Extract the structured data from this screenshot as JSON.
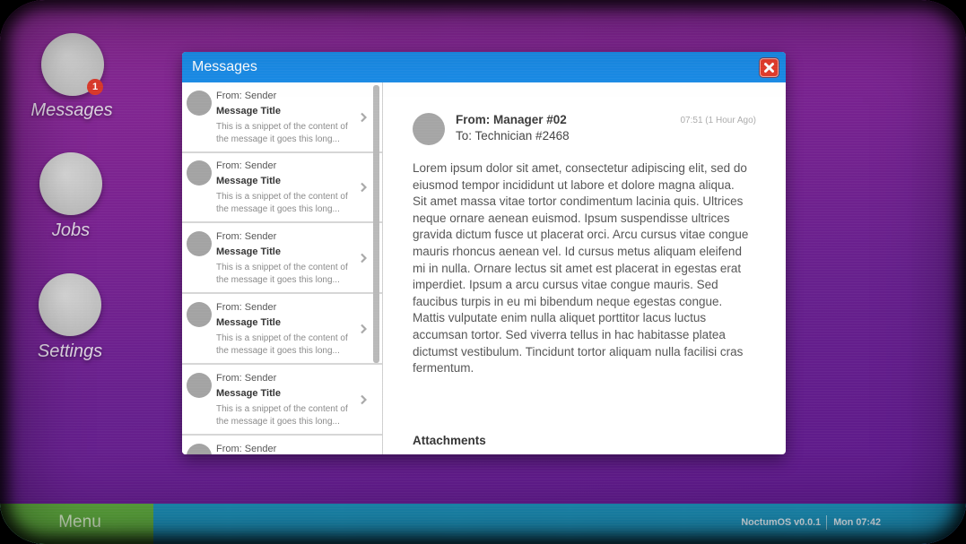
{
  "desktop": {
    "icons": [
      {
        "label": "Messages",
        "badge": "1"
      },
      {
        "label": "Jobs"
      },
      {
        "label": "Settings"
      }
    ]
  },
  "window": {
    "title": "Messages",
    "close_icon": "close-icon"
  },
  "message_list": {
    "item_icon": "chevron-right-icon",
    "items": [
      {
        "from": "From: Sender",
        "title": "Message Title",
        "snippet": "This is a snippet of the content of the message it goes this long..."
      },
      {
        "from": "From: Sender",
        "title": "Message Title",
        "snippet": "This is a snippet of the content of the message it goes this long..."
      },
      {
        "from": "From: Sender",
        "title": "Message Title",
        "snippet": "This is a snippet of the content of the message it goes this long..."
      },
      {
        "from": "From: Sender",
        "title": "Message Title",
        "snippet": "This is a snippet of the content of the message it goes this long..."
      },
      {
        "from": "From: Sender",
        "title": "Message Title",
        "snippet": "This is a snippet of the content of the message it goes this long..."
      },
      {
        "from": "From: Sender"
      }
    ]
  },
  "message": {
    "from": "From: Manager #02",
    "to": "To: Technician #2468",
    "time": "07:51 (1 Hour Ago)",
    "body_lines": [
      "Lorem ipsum dolor sit amet, consectetur adipiscing elit, sed do",
      "eiusmod tempor incididunt ut labore et dolore magna aliqua.",
      "Sit amet massa vitae tortor condimentum lacinia quis. Ultrices",
      "neque ornare aenean euismod. Ipsum suspendisse ultrices",
      "gravida dictum fusce ut placerat orci. Arcu cursus vitae congue",
      "mauris rhoncus aenean vel. Id cursus metus aliquam eleifend",
      "mi in nulla. Ornare lectus sit amet est placerat in egestas erat",
      "imperdiet. Ipsum a arcu cursus vitae congue mauris. Sed",
      "faucibus turpis in eu mi bibendum neque egestas congue.",
      "Mattis vulputate enim nulla aliquet porttitor lacus luctus",
      "accumsan tortor. Sed viverra tellus in hac habitasse platea",
      "dictumst vestibulum. Tincidunt tortor aliquam nulla facilisi cras",
      "fermentum."
    ],
    "attachments_heading": "Attachments"
  },
  "taskbar": {
    "menu_label": "Menu",
    "os_version": "NoctumOS v0.0.1",
    "clock": "Mon 07:42"
  },
  "colors": {
    "title_bar": "#1a8be6",
    "close_button": "#e33b2b",
    "badge": "#d9382a",
    "menu_button": "#5ba53c",
    "taskbar": "#1b8cb4",
    "desktop_top": "#8a2a92",
    "desktop_bottom": "#5a1889"
  }
}
